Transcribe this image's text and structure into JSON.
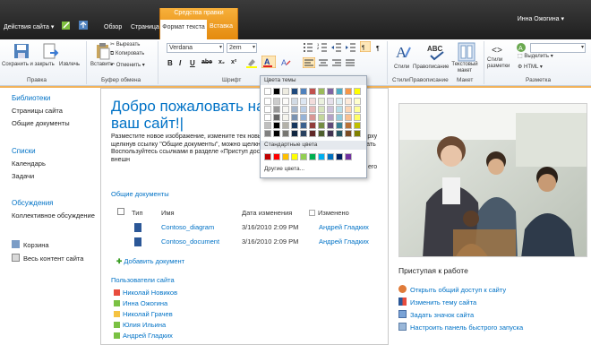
{
  "topbar": {
    "site_actions": "Действия сайта ▾",
    "tab_browse": "Обзор",
    "tab_page": "Страница",
    "context_group": "Средства правки",
    "tab_format_text": "Формат текста",
    "tab_insert": "Вставка",
    "user": "Инна Ожогина ▾"
  },
  "ribbon": {
    "save_close": "Сохранить и закрыть",
    "check_out": "Извлечь",
    "paste": "Вставить",
    "cut": "Вырезать",
    "copy": "Копировать",
    "undo": "Отменить",
    "font_name": "Verdana",
    "font_size": "2em",
    "styles": "Стили",
    "spelling": "Правописание",
    "text_layout": "Текстовый макет",
    "markup_styles": "Стили разметки",
    "select": "Выделить",
    "html": "HTML",
    "group_edit": "Правка",
    "group_clipboard": "Буфер обмена",
    "group_font": "Шрифт",
    "group_styles": "Стили",
    "group_spelling": "Правописание",
    "group_layout": "Макет",
    "group_markup": "Разметка"
  },
  "leftnav": {
    "libraries": "Библиотеки",
    "site_pages": "Страницы сайта",
    "shared_docs": "Общие документы",
    "lists": "Списки",
    "calendar": "Календарь",
    "tasks": "Задачи",
    "discussions": "Обсуждения",
    "team_discussion": "Коллективное обсуждение",
    "recycle_bin": "Корзина",
    "all_content": "Весь контент сайта"
  },
  "main": {
    "welcome": "Добро пожаловать на ваш сайт!|",
    "intro": "Разместите новое изображение, измените тек новые списки на эту страницу, нажав вверху щелкнув ссылку \"Общие документы\", можно щелкнув ссылку «Календарь», можно создать Воспользуйтесь ссылками в разделе «Приступ доступа к своему сайту и настройке его внешн",
    "intro_tail": "его",
    "docs_title": "Общие документы",
    "col_type": "Тип",
    "col_name": "Имя",
    "col_modified_date": "Дата изменения",
    "col_modified_by": "Изменено",
    "docs": [
      {
        "name": "Contoso_diagram",
        "date": "3/16/2010 2:09 PM",
        "author": "Андрей Гладких"
      },
      {
        "name": "Contoso_document",
        "date": "3/16/2010 2:09 PM",
        "author": "Андрей Гладких"
      }
    ],
    "add_document": "Добавить документ",
    "users_title": "Пользователи сайта",
    "users": [
      {
        "name": "Николай Новиков",
        "color": "#e84c3d"
      },
      {
        "name": "Инна Ожогина",
        "color": "#7ac143"
      },
      {
        "name": "Николай Грачев",
        "color": "#f5c342"
      },
      {
        "name": "Юлия Ильина",
        "color": "#7ac143"
      },
      {
        "name": "Андрей Гладких",
        "color": "#7ac143"
      }
    ]
  },
  "right": {
    "getting_started": "Приступая к работе",
    "items": [
      "Открыть общий доступ к сайту",
      "Изменить тему сайта",
      "Задать значок сайта",
      "Настроить панель быстрого запуска"
    ]
  },
  "color_picker": {
    "theme_colors": "Цвета темы",
    "standard_colors": "Стандартные цвета",
    "more_colors": "Другие цвета...",
    "theme_row": [
      "#ffffff",
      "#000000",
      "#eeece1",
      "#1f497d",
      "#4f81bd",
      "#c0504d",
      "#9bbb59",
      "#8064a2",
      "#4bacc6",
      "#f79646",
      "#ffff00"
    ],
    "standard_row": [
      "#c00000",
      "#ff0000",
      "#ffc000",
      "#ffff00",
      "#92d050",
      "#00b050",
      "#00b0f0",
      "#0070c0",
      "#002060",
      "#7030a0"
    ]
  }
}
